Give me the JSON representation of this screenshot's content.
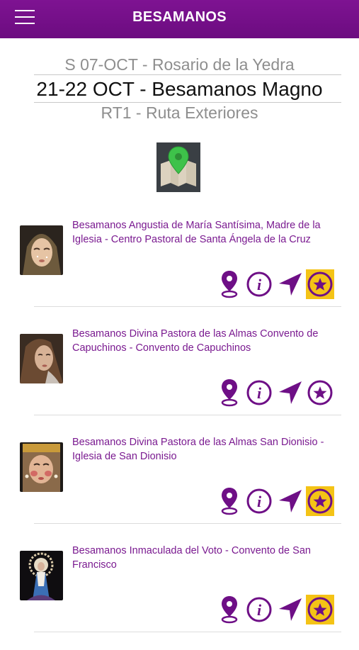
{
  "header": {
    "title": "BESAMANOS",
    "colors": {
      "bar": "#7a1390",
      "text": "#ffffff"
    }
  },
  "picker": {
    "above_faint": "",
    "previous": "S 07-OCT - Rosario de la Yedra",
    "selected": "21-22 OCT - Besamanos Magno",
    "next": "RT1 - Ruta Exteriores",
    "below_faint": ""
  },
  "map_button": {
    "icon": "map-pin-icon"
  },
  "items": [
    {
      "title": "Besamanos Angustia de María Santísima, Madre de la Iglesia - Centro Pastoral de Santa Ángela de la Cruz",
      "favorite": true
    },
    {
      "title": "Besamanos Divina Pastora de las Almas Convento de Capuchinos - Convento de Capuchinos",
      "favorite": false
    },
    {
      "title": "Besamanos Divina Pastora de las Almas San Dionisio - Iglesia de San Dionisio",
      "favorite": true
    },
    {
      "title": "Besamanos Inmaculada del Voto - Convento de San Francisco",
      "favorite": true
    }
  ],
  "action_icons": [
    "location-pin-icon",
    "info-icon",
    "navigate-arrow-icon",
    "star-favorite-icon"
  ],
  "accent": {
    "purple": "#7a1a90",
    "gold": "#f4c316"
  }
}
